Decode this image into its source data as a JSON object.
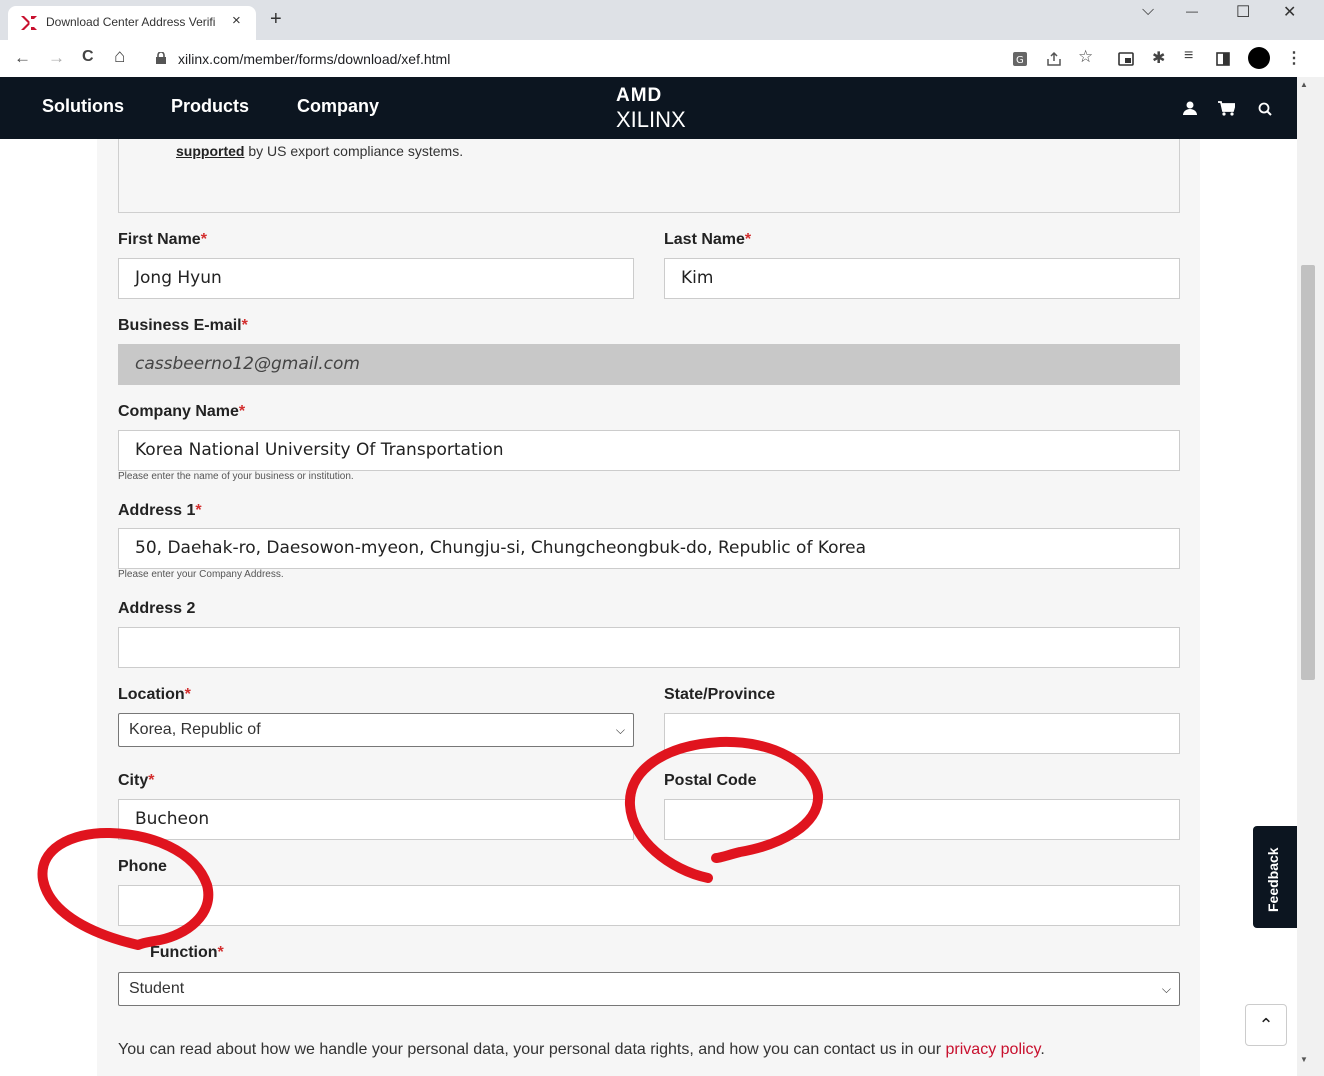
{
  "browser": {
    "tab_title": "Download Center Address Verifi",
    "tab_close": "×",
    "new_tab": "+",
    "url": "xilinx.com/member/forms/download/xef.html",
    "controls": {
      "chevron": "⌵",
      "minimize": "—",
      "maximize": "☐",
      "close": "✕"
    },
    "nav": {
      "back": "←",
      "forward": "→",
      "reload": "C",
      "home": "⌂"
    },
    "icons": [
      "translate-icon",
      "share-icon",
      "star-icon",
      "media-icon",
      "extensions-icon",
      "reading-list-icon",
      "side-panel-icon",
      "profile-icon",
      "menu-icon"
    ]
  },
  "header": {
    "nav": [
      "Solutions",
      "Products",
      "Company"
    ],
    "logo_top": "AMD",
    "logo_bottom": "XILINX"
  },
  "notice": {
    "link": "supported",
    "text": " by US export compliance systems."
  },
  "form": {
    "first_name": {
      "label": "First Name",
      "value": "Jong Hyun"
    },
    "last_name": {
      "label": "Last Name",
      "value": "Kim"
    },
    "email": {
      "label": "Business E-mail",
      "value": "cassbeerno12@gmail.com"
    },
    "company": {
      "label": "Company Name",
      "value": "Korea National University Of Transportation",
      "help": "Please enter the name of your business or institution."
    },
    "address1": {
      "label": "Address 1",
      "value": "50, Daehak-ro, Daesowon-myeon, Chungju-si, Chungcheongbuk-do, Republic of Korea",
      "help": "Please enter your Company Address."
    },
    "address2": {
      "label": "Address 2",
      "value": ""
    },
    "location": {
      "label": "Location",
      "value": "Korea, Republic of"
    },
    "state": {
      "label": "State/Province",
      "value": ""
    },
    "city": {
      "label": "City",
      "value": "Bucheon"
    },
    "postal": {
      "label": "Postal Code",
      "value": ""
    },
    "phone": {
      "label": "Phone",
      "value": ""
    },
    "job_function": {
      "label": "Function",
      "value": "Student"
    },
    "required_mark": "*"
  },
  "privacy": {
    "text": "You can read about how we handle your personal data, your personal data rights, and how you can contact us in our ",
    "link": "privacy policy",
    "end": "."
  },
  "feedback": "Feedback",
  "to_top": "⌃",
  "colors": {
    "header": "#0c1520",
    "required": "#d32f2f",
    "annotation": "#e0141e",
    "link": "#c8102e"
  }
}
